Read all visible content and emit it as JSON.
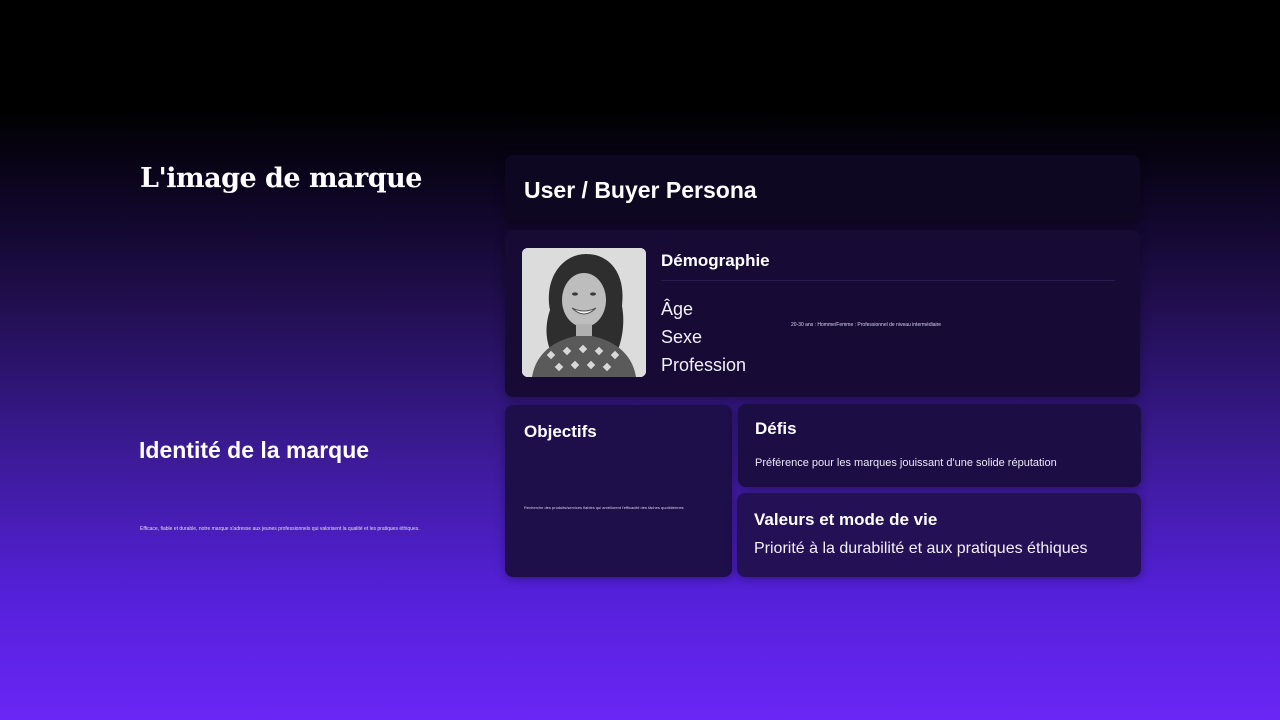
{
  "brand": {
    "title": "L'image de marque"
  },
  "identity": {
    "title": "Identité de la marque",
    "text": "Efficace, fiable et durable, notre marque s'adresse aux jeunes professionnels qui valorisent la qualité et les pratiques éthiques."
  },
  "persona": {
    "title": "User / Buyer Persona",
    "photo_icon": "person-portrait-photo",
    "demographics": {
      "title": "Démographie",
      "labels": [
        "Âge",
        "Sexe",
        "Profession"
      ],
      "values": "20-30 ans : Homme/Femme : Professionnel de niveau intermédiaire"
    },
    "objectives": {
      "title": "Objectifs",
      "text": "Recherche des produits/services fiables qui améliorent l'efficacité des tâches quotidiennes"
    },
    "challenges": {
      "title": "Défis",
      "text": "Préférence pour les marques jouissant d'une solide réputation"
    },
    "values": {
      "title": "Valeurs et mode de vie",
      "text": "Priorité à la durabilité et aux pratiques éthiques"
    }
  },
  "colors": {
    "background_top": "#000000",
    "background_bottom": "#6a26f6",
    "card_dark": "#0e0722",
    "card_mid": "#170b36"
  }
}
